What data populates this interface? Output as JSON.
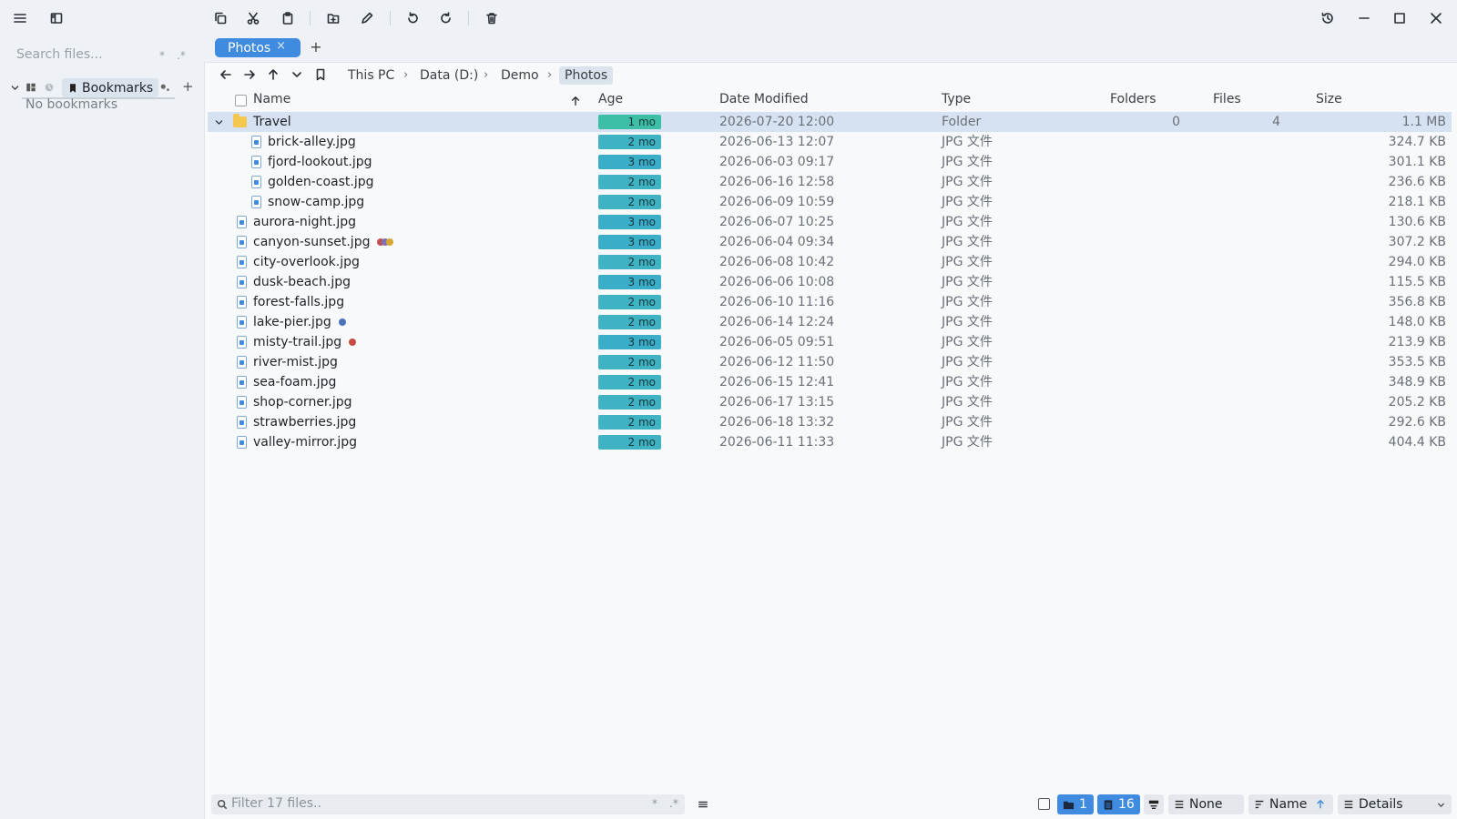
{
  "window": {
    "title": "Photos"
  },
  "sidebar": {
    "search_placeholder": "Search files...",
    "search_suffix_glob": "*",
    "search_suffix_regex": ".*",
    "bookmarks_label": "Bookmarks",
    "empty_text": "No bookmarks",
    "add_label": "+"
  },
  "tabs": [
    {
      "label": "Photos",
      "close": "×"
    }
  ],
  "tab_add": "+",
  "breadcrumb": [
    "This PC",
    "Data (D:)",
    "Demo",
    "Photos"
  ],
  "breadcrumb_sep": "›",
  "columns": {
    "name": "Name",
    "age": "Age",
    "date": "Date Modified",
    "type": "Type",
    "folders": "Folders",
    "files": "Files",
    "size": "Size"
  },
  "rows": [
    {
      "name": "Travel",
      "kind": "folder",
      "indent": 0,
      "expanded": true,
      "selected": true,
      "age": "1 mo",
      "date": "2026-07-20 12:00",
      "type": "Folder",
      "folders": "0",
      "files": "4",
      "size": "1.1 MB"
    },
    {
      "name": "brick-alley.jpg",
      "kind": "file",
      "indent": 1,
      "age": "2 mo",
      "date": "2026-06-13 12:07",
      "type": "JPG 文件",
      "size": "324.7 KB"
    },
    {
      "name": "fjord-lookout.jpg",
      "kind": "file",
      "indent": 1,
      "age": "3 mo",
      "date": "2026-06-03 09:17",
      "type": "JPG 文件",
      "size": "301.1 KB"
    },
    {
      "name": "golden-coast.jpg",
      "kind": "file",
      "indent": 1,
      "age": "2 mo",
      "date": "2026-06-16 12:58",
      "type": "JPG 文件",
      "size": "236.6 KB"
    },
    {
      "name": "snow-camp.jpg",
      "kind": "file",
      "indent": 1,
      "age": "2 mo",
      "date": "2026-06-09 10:59",
      "type": "JPG 文件",
      "size": "218.1 KB"
    },
    {
      "name": "aurora-night.jpg",
      "kind": "file",
      "indent": 0,
      "age": "3 mo",
      "date": "2026-06-07 10:25",
      "type": "JPG 文件",
      "size": "130.6 KB"
    },
    {
      "name": "canyon-sunset.jpg",
      "kind": "file",
      "indent": 0,
      "age": "3 mo",
      "date": "2026-06-04 09:34",
      "type": "JPG 文件",
      "size": "307.2 KB",
      "tags": [
        "#c0504d",
        "#7f6fb6",
        "#d7a531"
      ]
    },
    {
      "name": "city-overlook.jpg",
      "kind": "file",
      "indent": 0,
      "age": "2 mo",
      "date": "2026-06-08 10:42",
      "type": "JPG 文件",
      "size": "294.0 KB"
    },
    {
      "name": "dusk-beach.jpg",
      "kind": "file",
      "indent": 0,
      "age": "3 mo",
      "date": "2026-06-06 10:08",
      "type": "JPG 文件",
      "size": "115.5 KB"
    },
    {
      "name": "forest-falls.jpg",
      "kind": "file",
      "indent": 0,
      "age": "2 mo",
      "date": "2026-06-10 11:16",
      "type": "JPG 文件",
      "size": "356.8 KB"
    },
    {
      "name": "lake-pier.jpg",
      "kind": "file",
      "indent": 0,
      "age": "2 mo",
      "date": "2026-06-14 12:24",
      "type": "JPG 文件",
      "size": "148.0 KB",
      "tags": [
        "#4a72b8"
      ]
    },
    {
      "name": "misty-trail.jpg",
      "kind": "file",
      "indent": 0,
      "age": "3 mo",
      "date": "2026-06-05 09:51",
      "type": "JPG 文件",
      "size": "213.9 KB",
      "tags": [
        "#c84a44"
      ]
    },
    {
      "name": "river-mist.jpg",
      "kind": "file",
      "indent": 0,
      "age": "2 mo",
      "date": "2026-06-12 11:50",
      "type": "JPG 文件",
      "size": "353.5 KB"
    },
    {
      "name": "sea-foam.jpg",
      "kind": "file",
      "indent": 0,
      "age": "2 mo",
      "date": "2026-06-15 12:41",
      "type": "JPG 文件",
      "size": "348.9 KB"
    },
    {
      "name": "shop-corner.jpg",
      "kind": "file",
      "indent": 0,
      "age": "2 mo",
      "date": "2026-06-17 13:15",
      "type": "JPG 文件",
      "size": "205.2 KB"
    },
    {
      "name": "strawberries.jpg",
      "kind": "file",
      "indent": 0,
      "age": "2 mo",
      "date": "2026-06-18 13:32",
      "type": "JPG 文件",
      "size": "292.6 KB"
    },
    {
      "name": "valley-mirror.jpg",
      "kind": "file",
      "indent": 0,
      "age": "2 mo",
      "date": "2026-06-11 11:33",
      "type": "JPG 文件",
      "size": "404.4 KB"
    }
  ],
  "age_colors": {
    "1 mo": "#3dbfa6",
    "2 mo": "#3fb3c4",
    "3 mo": "#3aaec9"
  },
  "footer": {
    "filter_placeholder": "Filter 17 files..",
    "filter_glob": "*",
    "filter_regex": ".*",
    "folders_count": "1",
    "files_count": "16",
    "group_label": "None",
    "sort_label": "Name",
    "view_label": "Details"
  },
  "colors": {
    "accent": "#3f8be0",
    "selection": "#d6e2f1"
  }
}
